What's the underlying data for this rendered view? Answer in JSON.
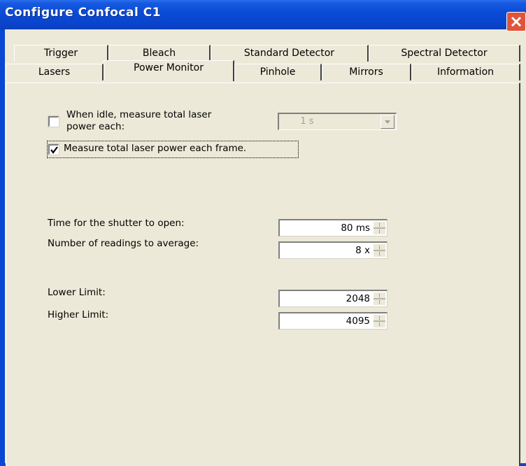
{
  "window": {
    "title": "Configure Confocal C1"
  },
  "tabs_row1": [
    {
      "label": "Trigger"
    },
    {
      "label": "Bleach"
    },
    {
      "label": "Standard Detector"
    },
    {
      "label": "Spectral Detector"
    }
  ],
  "tabs_row2": [
    {
      "label": "Lasers"
    },
    {
      "label": "Power Monitor"
    },
    {
      "label": "Pinhole"
    },
    {
      "label": "Mirrors"
    },
    {
      "label": "Information"
    }
  ],
  "active_tab": "Power Monitor",
  "power_monitor": {
    "idle_measure": {
      "label_line1": "When idle, measure total laser",
      "label_line2": "power each:",
      "checked": false
    },
    "idle_interval": {
      "value": "1 s",
      "enabled": false
    },
    "each_frame": {
      "label": "Measure total laser power each frame.",
      "checked": true
    },
    "shutter_time": {
      "label": "Time for the shutter to open:",
      "value": "80 ms"
    },
    "readings_avg": {
      "label": "Number of readings to average:",
      "value": "8 x"
    },
    "lower_limit": {
      "label": "Lower Limit:",
      "value": "2048"
    },
    "higher_limit": {
      "label": "Higher Limit:",
      "value": "4095"
    }
  },
  "colors": {
    "titlebar": "#0a4bd6",
    "close": "#e0553a",
    "face": "#ece9d8"
  }
}
